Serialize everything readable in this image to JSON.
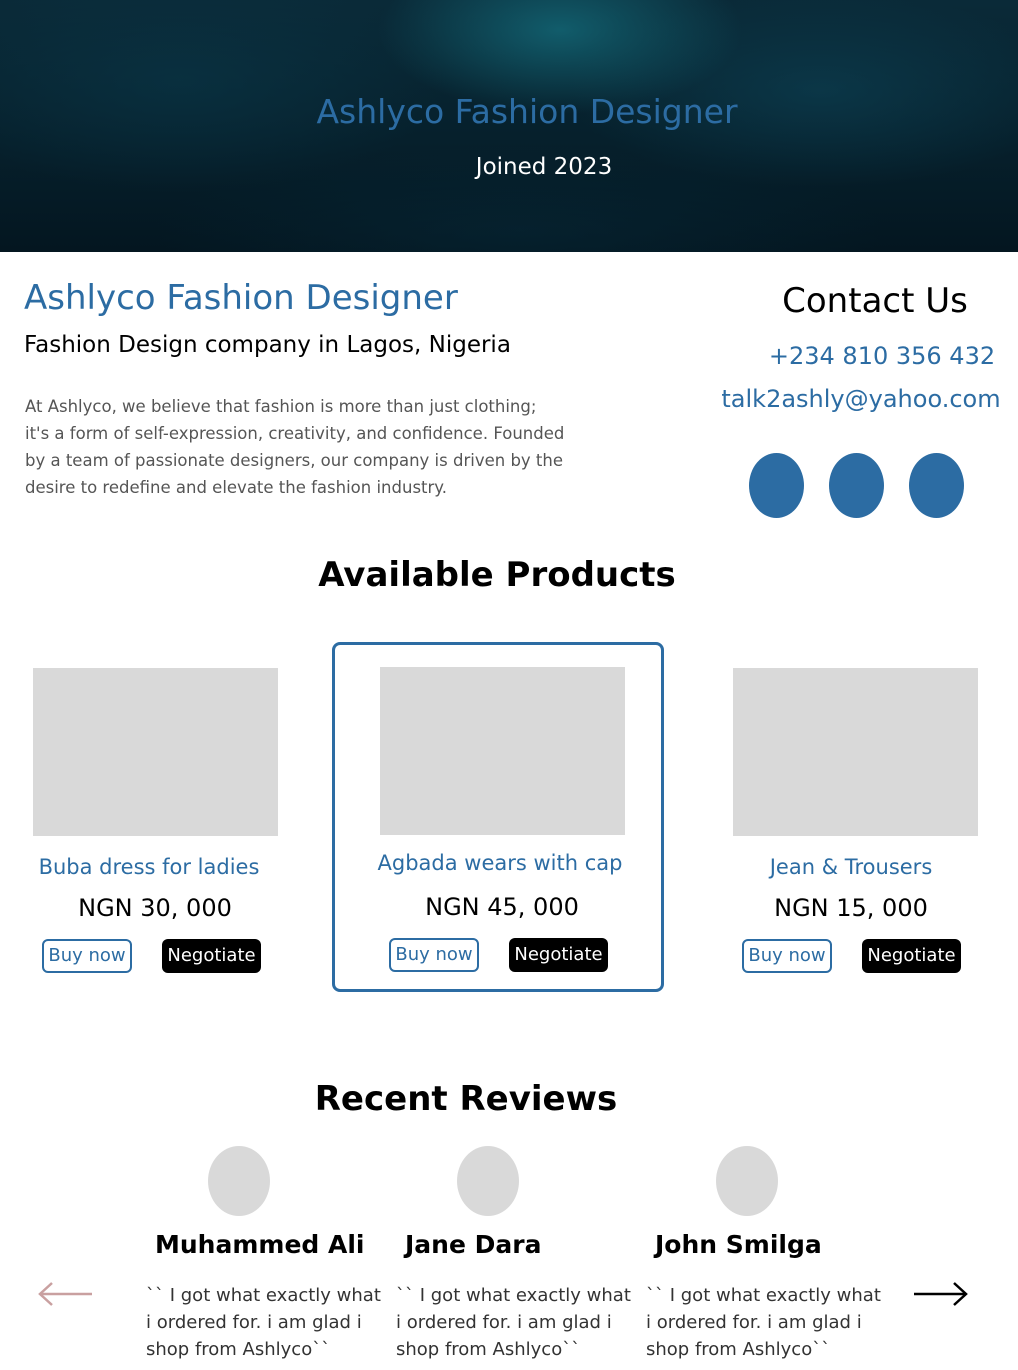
{
  "hero": {
    "title": "Ashlyco Fashion Designer",
    "joined": "Joined 2023"
  },
  "company": {
    "name": "Ashlyco Fashion Designer",
    "subtitle": "Fashion Design company in Lagos, Nigeria",
    "description": "At Ashlyco, we believe that fashion is more than just clothing; it's a form of self-expression, creativity, and confidence. Founded by a team of passionate designers, our company is driven by the desire to redefine and elevate the fashion industry."
  },
  "contact": {
    "title": "Contact Us",
    "phone": "+234 810 356 432",
    "email": "talk2ashly@yahoo.com"
  },
  "products": {
    "title": "Available Products",
    "items": [
      {
        "name": "Buba dress for ladies",
        "price": "NGN 30, 000",
        "buy_label": "Buy now",
        "negotiate_label": "Negotiate"
      },
      {
        "name": "Agbada wears with cap",
        "price": "NGN 45, 000",
        "buy_label": "Buy now",
        "negotiate_label": "Negotiate"
      },
      {
        "name": "Jean & Trousers",
        "price": "NGN 15, 000",
        "buy_label": "Buy now",
        "negotiate_label": "Negotiate"
      }
    ]
  },
  "reviews": {
    "title": "Recent Reviews",
    "items": [
      {
        "name": "Muhammed Ali",
        "text": "`` I got what exactly what i ordered for. i am glad i shop from Ashlyco``"
      },
      {
        "name": "Jane Dara",
        "text": "`` I got what exactly what i ordered for. i am glad i shop from Ashlyco``"
      },
      {
        "name": "John Smilga",
        "text": "`` I got what exactly what i ordered for. i am glad i shop from Ashlyco``"
      }
    ]
  },
  "colors": {
    "accent": "#2c6ca3",
    "placeholder": "#d9d9d9",
    "arrow_inactive": "#c9a0a0"
  },
  "icons": {
    "prev": "arrow-left-icon",
    "next": "arrow-right-icon"
  }
}
